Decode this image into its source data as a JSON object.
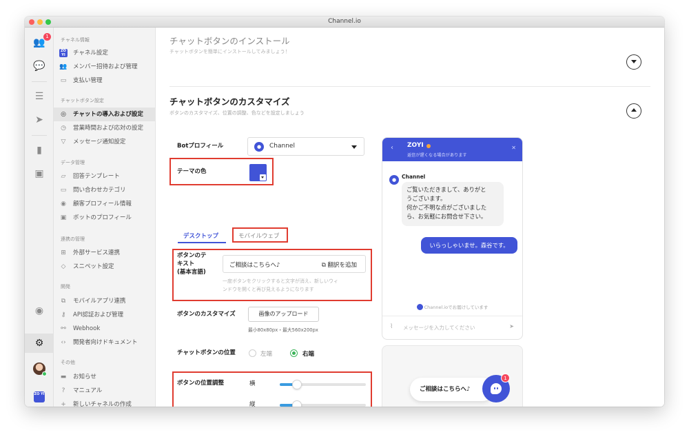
{
  "window": {
    "title": "Channel.io"
  },
  "rail": {
    "notification_count": "1",
    "workspace_logo": "ZO YI"
  },
  "sidebar": {
    "sections": [
      {
        "heading": "チャネル情報",
        "items": [
          {
            "label": "チャネル設定",
            "icon": "brand-icon"
          },
          {
            "label": "メンバー招待および管理",
            "icon": "members-icon"
          },
          {
            "label": "支払い管理",
            "icon": "card-icon"
          }
        ]
      },
      {
        "heading": "チャットボタン設定",
        "items": [
          {
            "label": "チャットの導入および設定",
            "icon": "chat-icon"
          },
          {
            "label": "営業時間および応対の設定",
            "icon": "clock-icon"
          },
          {
            "label": "メッセージ通知設定",
            "icon": "send-icon"
          }
        ]
      },
      {
        "heading": "データ管理",
        "items": [
          {
            "label": "回答テンプレート",
            "icon": "template-icon"
          },
          {
            "label": "問い合わせカテゴリ",
            "icon": "folder-icon"
          },
          {
            "label": "顧客プロフィール情報",
            "icon": "profile-icon"
          },
          {
            "label": "ボットのプロフィール",
            "icon": "bot-icon"
          }
        ]
      },
      {
        "heading": "連携の管理",
        "items": [
          {
            "label": "外部サービス連携",
            "icon": "grid-icon"
          },
          {
            "label": "スニペット設定",
            "icon": "cube-icon"
          }
        ]
      },
      {
        "heading": "開発",
        "items": [
          {
            "label": "モバイルアプリ連携",
            "icon": "link-icon"
          },
          {
            "label": "API認証および管理",
            "icon": "key-icon"
          },
          {
            "label": "Webhook",
            "icon": "webhook-icon"
          },
          {
            "label": "開発者向けドキュメント",
            "icon": "code-icon"
          }
        ]
      },
      {
        "heading": "その他",
        "items": [
          {
            "label": "お知らせ",
            "icon": "new-icon"
          },
          {
            "label": "マニュアル",
            "icon": "help-icon"
          },
          {
            "label": "新しいチャネルの作成",
            "icon": "plus-icon"
          }
        ]
      }
    ]
  },
  "install": {
    "title": "チャットボタンのインストール",
    "subtitle": "チャットボタンを簡単にインストールしてみましょう！"
  },
  "customize": {
    "title": "チャットボタンのカスタマイズ",
    "subtitle": "ボタンのカスタマイズ、位置の調整、色などを設定しましょう",
    "bot_profile_label": "Botプロフィール",
    "bot_profile_value": "Channel",
    "theme_label": "テーマの色",
    "theme_color": "#4154d7",
    "tabs": [
      "デスクトップ",
      "モバイルウェブ"
    ],
    "button_text_label_1": "ボタンのテ",
    "button_text_label_2": "キスト",
    "button_text_label_3": "(基本言語)",
    "button_text_value": "ご相談はこちらへ♪",
    "translate_label": "翻訳を追加",
    "button_text_help_1": "一度ボタンをクリックすると文字が消え、新しいウィ",
    "button_text_help_2": "ンドウを開くと再び見えるようになります",
    "button_custom_label": "ボタンのカスタマイズ",
    "upload_label": "画像のアップロード",
    "upload_hint": "最小80x80px・最大560x200px",
    "position_label": "チャットボタンの位置",
    "position_left": "左端",
    "position_right": "右端",
    "position_selected": "右端",
    "adjust_label": "ボタンの位置調整",
    "horizontal_label": "横",
    "vertical_label": "縦",
    "horizontal_value": 0.2,
    "vertical_value": 0.2
  },
  "preview": {
    "name": "ZOYI",
    "status": "返信が遅くなる場合があります",
    "bot_name": "Channel",
    "bot_msg_1": "ご覧いただきまして、ありがと",
    "bot_msg_2": "うございます。",
    "bot_msg_3": "何かご不明な点がございました",
    "bot_msg_4": "ら、お気軽にお問合せ下さい。",
    "user_msg": "いらっしゃいませ。森谷です。",
    "powered": "Channel.ioでお届けしています",
    "input_placeholder": "メッセージを入力してください",
    "launcher_text": "ご相談はこちらへ♪",
    "launcher_badge": "1"
  }
}
